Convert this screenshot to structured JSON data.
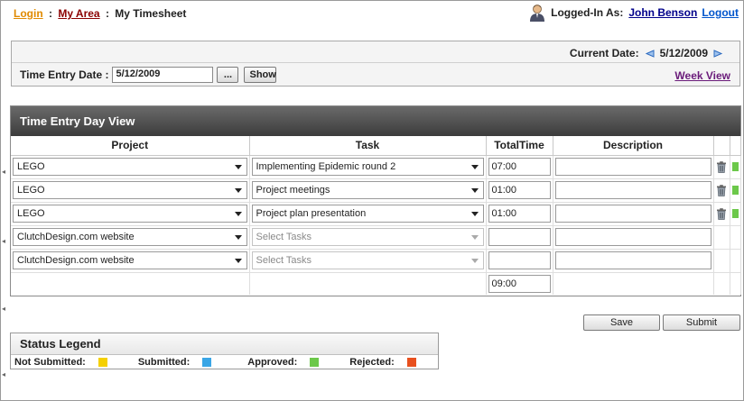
{
  "breadcrumb": {
    "login": "Login",
    "separator": ":",
    "my_area": "My Area",
    "current": "My Timesheet"
  },
  "user": {
    "label": "Logged-In As:",
    "name": "John Benson",
    "logout": "Logout"
  },
  "date_panel": {
    "current_date_label": "Current Date:",
    "current_date": "5/12/2009",
    "entry_date_label": "Time Entry Date :",
    "entry_date_value": "5/12/2009",
    "picker_button": "...",
    "show_button": "Show",
    "week_view_link": "Week View"
  },
  "day_view": {
    "title": "Time Entry Day View",
    "columns": [
      "Project",
      "Task",
      "TotalTime",
      "Description"
    ],
    "rows": [
      {
        "project": "LEGO",
        "task": "Implementing Epidemic round 2",
        "time": "07:00",
        "description": "",
        "status": "approved"
      },
      {
        "project": "LEGO",
        "task": "Project meetings",
        "time": "01:00",
        "description": "",
        "status": "approved"
      },
      {
        "project": "LEGO",
        "task": "Project plan presentation",
        "time": "01:00",
        "description": "",
        "status": "approved"
      },
      {
        "project": "ClutchDesign.com website",
        "task": "Select Tasks",
        "time": "",
        "description": ""
      },
      {
        "project": "ClutchDesign.com website",
        "task": "Select Tasks",
        "time": "",
        "description": ""
      }
    ],
    "total": "09:00"
  },
  "actions": {
    "save": "Save",
    "submit": "Submit"
  },
  "legend": {
    "title": "Status Legend",
    "items": [
      {
        "label": "Not Submitted:",
        "color": "#f5d000"
      },
      {
        "label": "Submitted:",
        "color": "#3aa6e6"
      },
      {
        "label": "Approved:",
        "color": "#6cc84a"
      },
      {
        "label": "Rejected:",
        "color": "#e8501e"
      }
    ]
  },
  "colors": {
    "approved": "#6cc84a",
    "header_bar": "#4a4a4a",
    "link_login": "#e08a00",
    "link_area": "#8b0000",
    "week_view": "#6a1b7a"
  }
}
